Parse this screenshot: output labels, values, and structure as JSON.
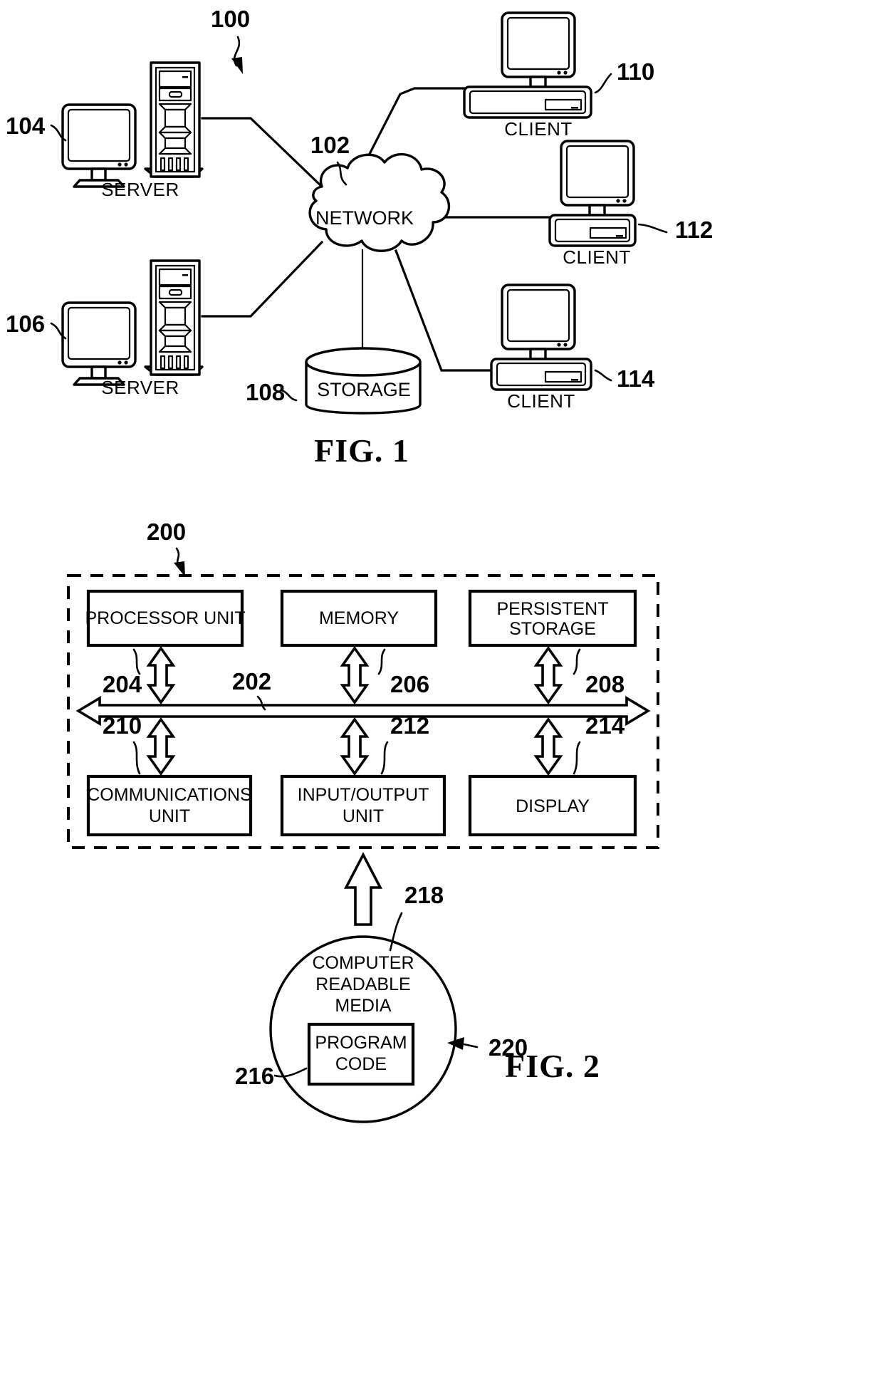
{
  "document": {
    "type": "patent-figure-sheet",
    "figures": [
      {
        "id": "fig1",
        "caption": "FIG. 1",
        "system_ref": "100",
        "nodes": [
          {
            "ref": "104",
            "label": "SERVER",
            "kind": "server-tower"
          },
          {
            "ref": "106",
            "label": "SERVER",
            "kind": "server-tower"
          },
          {
            "ref": "102",
            "label": "NETWORK",
            "kind": "cloud"
          },
          {
            "ref": "108",
            "label": "STORAGE",
            "kind": "cylinder"
          },
          {
            "ref": "110",
            "label": "CLIENT",
            "kind": "desktop-computer"
          },
          {
            "ref": "112",
            "label": "CLIENT",
            "kind": "desktop-computer"
          },
          {
            "ref": "114",
            "label": "CLIENT",
            "kind": "desktop-computer"
          }
        ]
      },
      {
        "id": "fig2",
        "caption": "FIG. 2",
        "system_ref": "200",
        "bus_ref": "202",
        "blocks": [
          {
            "ref": "204",
            "label": "PROCESSOR UNIT"
          },
          {
            "ref": "206",
            "label": "MEMORY"
          },
          {
            "ref": "208",
            "label": "PERSISTENT STORAGE",
            "line1": "PERSISTENT",
            "line2": "STORAGE"
          },
          {
            "ref": "210",
            "label": "COMMUNICATIONS UNIT",
            "line1": "COMMUNICATIONS",
            "line2": "UNIT"
          },
          {
            "ref": "212",
            "label": "INPUT/OUTPUT UNIT",
            "line1": "INPUT/OUTPUT",
            "line2": "UNIT"
          },
          {
            "ref": "214",
            "label": "DISPLAY"
          }
        ],
        "media": {
          "ref": "218",
          "label": "COMPUTER READABLE MEDIA",
          "line1": "COMPUTER",
          "line2": "READABLE",
          "line3": "MEDIA",
          "program": {
            "ref": "216",
            "line1": "PROGRAM",
            "line2": "CODE"
          },
          "product_ref": "220"
        }
      }
    ]
  },
  "fig1": {
    "caption": "FIG. 1",
    "ref_100": "100",
    "ref_102": "102",
    "ref_104": "104",
    "ref_106": "106",
    "ref_108": "108",
    "ref_110": "110",
    "ref_112": "112",
    "ref_114": "114",
    "label_network": "NETWORK",
    "label_storage": "STORAGE",
    "label_server_top": "SERVER",
    "label_server_bottom": "SERVER",
    "label_client_top": "CLIENT",
    "label_client_mid": "CLIENT",
    "label_client_bottom": "CLIENT"
  },
  "fig2": {
    "caption": "FIG. 2",
    "ref_200": "200",
    "ref_202": "202",
    "ref_204": "204",
    "ref_206": "206",
    "ref_208": "208",
    "ref_210": "210",
    "ref_212": "212",
    "ref_214": "214",
    "ref_216": "216",
    "ref_218": "218",
    "ref_220": "220",
    "block_processor": "PROCESSOR UNIT",
    "block_memory": "MEMORY",
    "block_persistent_1": "PERSISTENT",
    "block_persistent_2": "STORAGE",
    "block_comm_1": "COMMUNICATIONS",
    "block_comm_2": "UNIT",
    "block_io_1": "INPUT/OUTPUT",
    "block_io_2": "UNIT",
    "block_display": "DISPLAY",
    "media_1": "COMPUTER",
    "media_2": "READABLE",
    "media_3": "MEDIA",
    "program_1": "PROGRAM",
    "program_2": "CODE"
  }
}
